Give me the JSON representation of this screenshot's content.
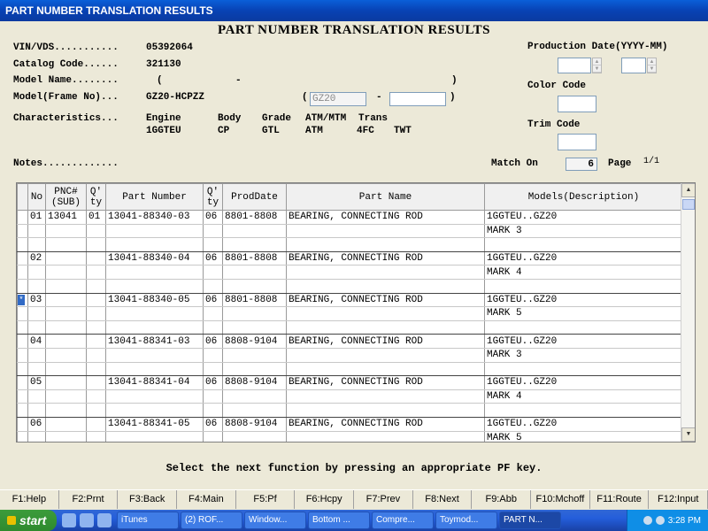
{
  "window": {
    "title": "PART NUMBER TRANSLATION RESULTS"
  },
  "heading": "PART NUMBER TRANSLATION RESULTS",
  "fields": {
    "vin_label": "VIN/VDS...........",
    "vin_value": "05392064",
    "catalog_label": "Catalog Code......",
    "catalog_value": "321130",
    "model_name_label": "Model Name........",
    "model_name_open": "(",
    "model_name_dash": "-",
    "model_name_close": ")",
    "model_frame_label": "Model(Frame No)...",
    "model_frame_value": "GZ20-HCPZZ",
    "frame_open": "(",
    "frame_input": "GZ20",
    "frame_dash": "-",
    "frame_close": ")",
    "characteristics_label": "Characteristics..."
  },
  "characteristics": [
    {
      "header": "Engine",
      "value": "1GGTEU"
    },
    {
      "header": "Body",
      "value": "CP"
    },
    {
      "header": "Grade",
      "value": "GTL"
    },
    {
      "header": "ATM/MTM",
      "value": "ATM"
    },
    {
      "header": "Trans",
      "value": "4FC"
    },
    {
      "header": "",
      "value": "TWT"
    }
  ],
  "right_panel": {
    "production_label": "Production Date(YYYY-MM)",
    "color_label": "Color Code",
    "trim_label": "Trim Code"
  },
  "notes_label": "Notes.............",
  "match_on_label": "Match On",
  "match_on_value": "6",
  "page_label": "Page",
  "page_value": "1/1",
  "table": {
    "headers": [
      "No",
      "PNC#\n(SUB)",
      "Q'\nty",
      "Part Number",
      "Q'\nty",
      "ProdDate",
      "Part Name",
      "Models(Description)"
    ],
    "rows": [
      {
        "no": "01",
        "pnc": "13041",
        "qty1": "01",
        "part_number": "13041-88340-03",
        "qty2": "06",
        "prod_date": "8801-8808",
        "part_name": "BEARING, CONNECTING ROD",
        "model1": "1GGTEU..GZ20",
        "model2": "MARK 3",
        "selected": false
      },
      {
        "no": "02",
        "pnc": "",
        "qty1": "",
        "part_number": "13041-88340-04",
        "qty2": "06",
        "prod_date": "8801-8808",
        "part_name": "BEARING, CONNECTING ROD",
        "model1": "1GGTEU..GZ20",
        "model2": "MARK 4",
        "selected": false
      },
      {
        "no": "03",
        "pnc": "",
        "qty1": "",
        "part_number": "13041-88340-05",
        "qty2": "06",
        "prod_date": "8801-8808",
        "part_name": "BEARING, CONNECTING ROD",
        "model1": "1GGTEU..GZ20",
        "model2": "MARK 5",
        "selected": true
      },
      {
        "no": "04",
        "pnc": "",
        "qty1": "",
        "part_number": "13041-88341-03",
        "qty2": "06",
        "prod_date": "8808-9104",
        "part_name": "BEARING, CONNECTING ROD",
        "model1": "1GGTEU..GZ20",
        "model2": "MARK 3",
        "selected": false
      },
      {
        "no": "05",
        "pnc": "",
        "qty1": "",
        "part_number": "13041-88341-04",
        "qty2": "06",
        "prod_date": "8808-9104",
        "part_name": "BEARING, CONNECTING ROD",
        "model1": "1GGTEU..GZ20",
        "model2": "MARK 4",
        "selected": false
      },
      {
        "no": "06",
        "pnc": "",
        "qty1": "",
        "part_number": "13041-88341-05",
        "qty2": "06",
        "prod_date": "8808-9104",
        "part_name": "BEARING, CONNECTING ROD",
        "model1": "1GGTEU..GZ20",
        "model2": "MARK 5",
        "selected": false
      }
    ],
    "selected_marker": "*"
  },
  "message": "Select the next function by pressing an appropriate PF key.",
  "pf_keys": [
    "F1:Help",
    "F2:Prnt",
    "F3:Back",
    "F4:Main",
    "F5:Pf",
    "F6:Hcpy",
    "F7:Prev",
    "F8:Next",
    "F9:Abb",
    "F10:Mchoff",
    "F11:Route",
    "F12:Input"
  ],
  "taskbar": {
    "start_label": "start",
    "tasks": [
      "iTunes",
      "(2) ROF...",
      "Window...",
      "Bottom ...",
      "Compre...",
      "Toymod...",
      "PART N..."
    ],
    "clock": "3:28 PM"
  }
}
